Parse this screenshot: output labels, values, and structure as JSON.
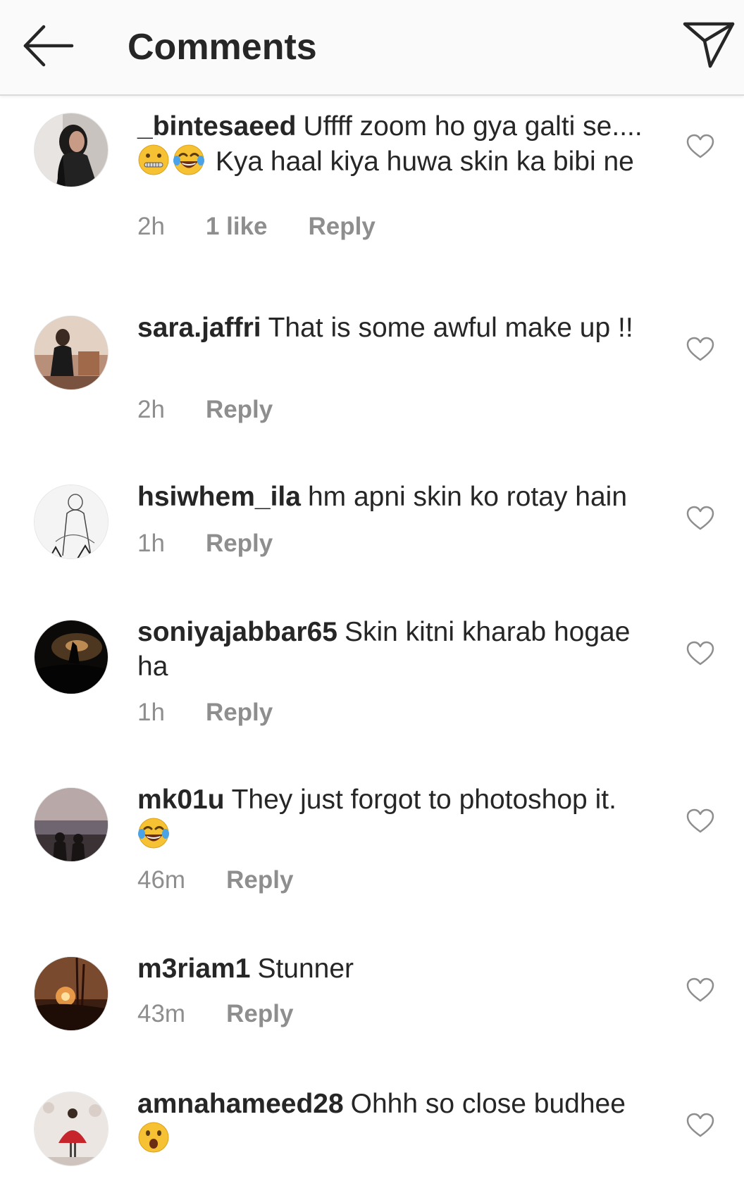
{
  "header": {
    "title": "Comments",
    "back_icon": "arrow-left-icon",
    "send_icon": "paper-plane-icon"
  },
  "colors": {
    "text": "#262626",
    "meta": "#8e8e8e",
    "header_bg": "#fafafa",
    "divider": "#dbdbdb"
  },
  "comments": [
    {
      "username": "_bintesaeed",
      "text_before_emoji": "Uffff zoom ho gya galti se....",
      "emojis": [
        "zipper-mouth-face-emoji",
        "tears-of-joy-emoji"
      ],
      "text_after_emoji": "Kya haal kiya huwa skin ka bibi ne",
      "time": "2h",
      "likes": "1 like",
      "reply": "Reply"
    },
    {
      "username": "sara.jaffri",
      "text": "That is some awful make up !!",
      "time": "2h",
      "reply": "Reply"
    },
    {
      "username": "hsiwhem_ila",
      "text": "hm apni skin ko rotay hain",
      "time": "1h",
      "reply": "Reply"
    },
    {
      "username": "soniyajabbar65",
      "text": "Skin kitni kharab hogae ha",
      "time": "1h",
      "reply": "Reply"
    },
    {
      "username": "mk01u",
      "text": "They just forgot to photoshop it.",
      "emojis": [
        "tears-of-joy-emoji"
      ],
      "time": "46m",
      "reply": "Reply"
    },
    {
      "username": "m3riam1",
      "text": "Stunner",
      "time": "43m",
      "reply": "Reply"
    },
    {
      "username": "amnahameed28",
      "text": "Ohhh so close budhee",
      "emojis": [
        "astonished-face-emoji"
      ],
      "time": "",
      "reply": ""
    }
  ]
}
